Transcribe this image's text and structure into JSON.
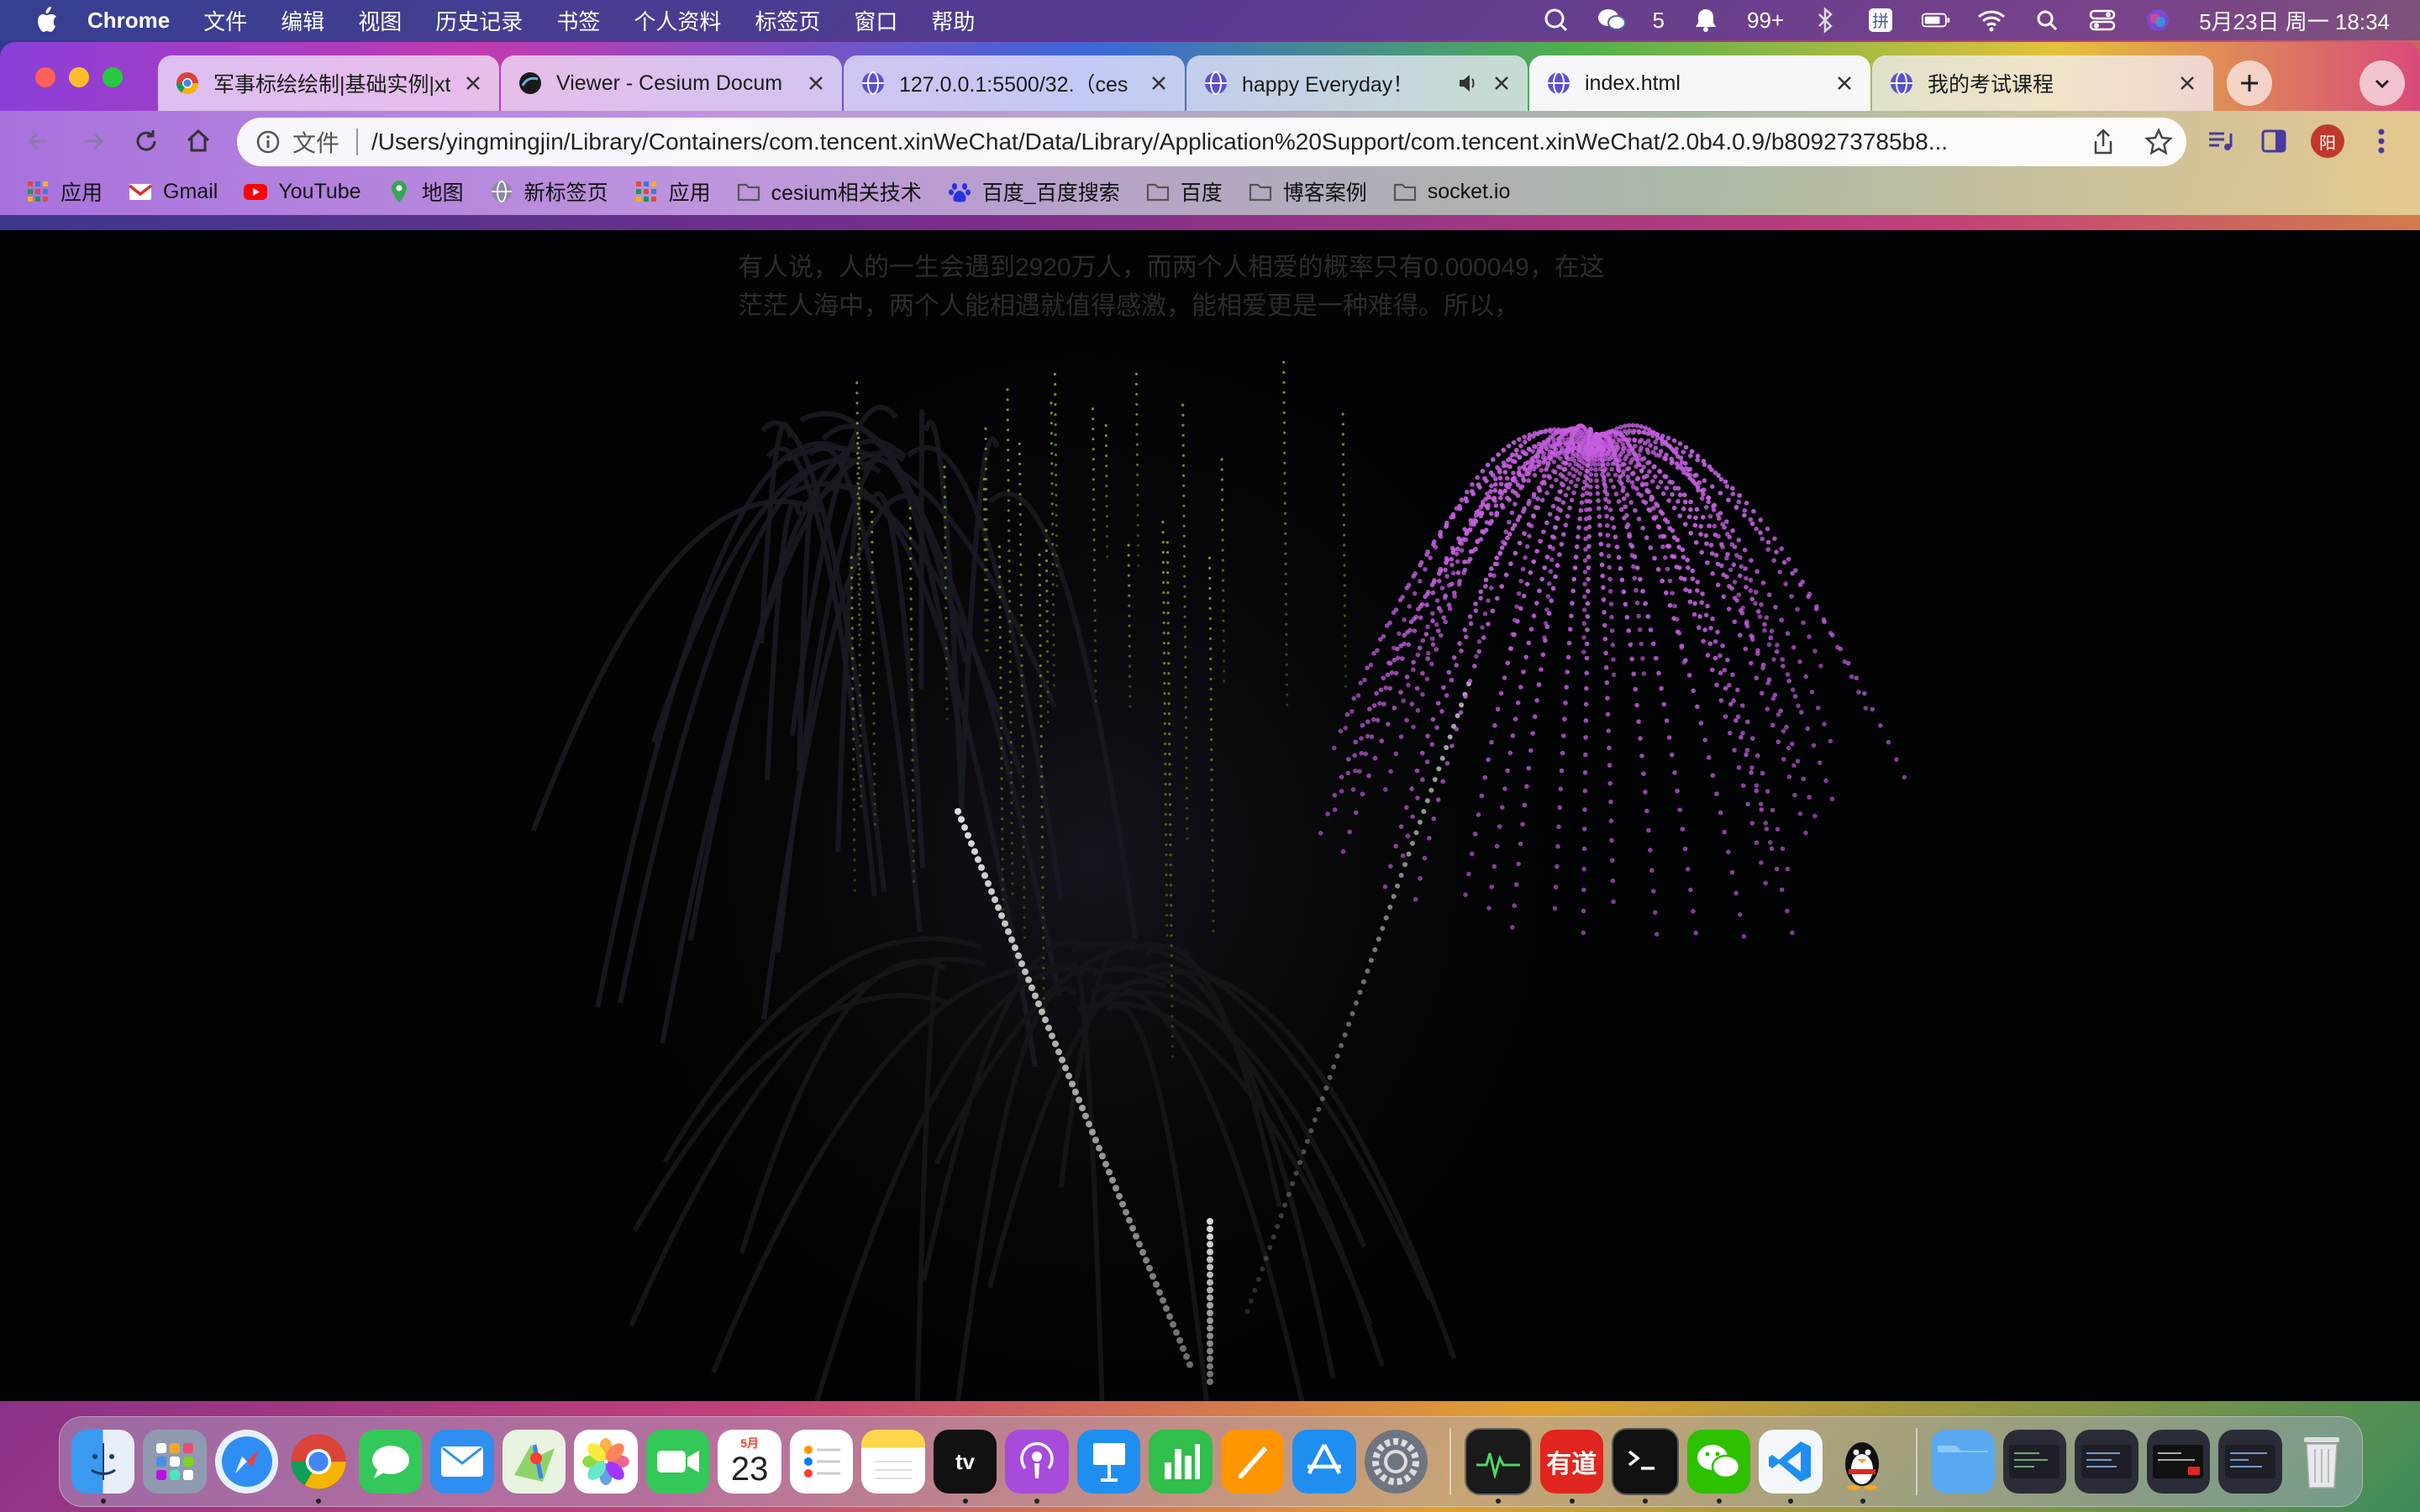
{
  "menubar": {
    "app_name": "Chrome",
    "menus": [
      "文件",
      "编辑",
      "视图",
      "历史记录",
      "书签",
      "个人资料",
      "标签页",
      "窗口",
      "帮助"
    ],
    "wechat_count": "5",
    "notification_count": "99+",
    "datetime": "5月23日 周一  18:34"
  },
  "tabs": [
    {
      "title": "军事标绘绘制|基础实例|xt",
      "icon": "chrome-favicon",
      "active": false
    },
    {
      "title": "Viewer - Cesium Docum",
      "icon": "cesium-favicon",
      "active": false
    },
    {
      "title": "127.0.0.1:5500/32.（ces",
      "icon": "globe-favicon",
      "active": false
    },
    {
      "title": "happy Everyday！",
      "icon": "globe-favicon",
      "active": false,
      "audio": true
    },
    {
      "title": "index.html",
      "icon": "globe-favicon",
      "active": true
    },
    {
      "title": "我的考试课程",
      "icon": "globe-favicon",
      "active": false
    }
  ],
  "toolbar": {
    "scheme_label": "文件",
    "url": "/Users/yingmingjin/Library/Containers/com.tencent.xinWeChat/Data/Library/Application%20Support/com.tencent.xinWeChat/2.0b4.0.9/b809273785b8...",
    "profile_initial": "阳"
  },
  "bookmarks": [
    {
      "label": "应用",
      "icon": "apps-grid-icon"
    },
    {
      "label": "Gmail",
      "icon": "gmail-icon"
    },
    {
      "label": "YouTube",
      "icon": "youtube-icon"
    },
    {
      "label": "地图",
      "icon": "maps-icon"
    },
    {
      "label": "新标签页",
      "icon": "globe-icon"
    },
    {
      "label": "应用",
      "icon": "apps-grid-icon"
    },
    {
      "label": "cesium相关技术",
      "icon": "folder-icon"
    },
    {
      "label": "百度_百度搜索",
      "icon": "baidu-icon"
    },
    {
      "label": "百度",
      "icon": "folder-icon"
    },
    {
      "label": "博客案例",
      "icon": "folder-icon"
    },
    {
      "label": "socket.io",
      "icon": "folder-icon"
    }
  ],
  "page": {
    "message_line1": "有人说，人的一生会遇到2920万人，而两个人相爱的概率只有0.000049，在这",
    "message_line2": "茫茫人海中，两个人能相遇就值得感激，能相爱更是一种难得。所以，"
  },
  "dock": {
    "calendar_month": "5月",
    "calendar_day": "23",
    "youdao_label": "有道",
    "apps": [
      "finder",
      "launchpad",
      "safari",
      "chrome",
      "messages",
      "mail",
      "maps",
      "photos",
      "facetime",
      "calendar",
      "reminders",
      "notes",
      "apple-tv",
      "podcasts",
      "keynote",
      "numbers",
      "pages",
      "app-store",
      "system-preferences",
      "activity-monitor",
      "youdao",
      "terminal",
      "wechat",
      "vscode",
      "qq"
    ]
  },
  "colors": {
    "firework_purple": "#c65ee0",
    "firework_green": "#9acd32",
    "rocket_trail": "#e8e8e8",
    "page_background": "#020304"
  }
}
